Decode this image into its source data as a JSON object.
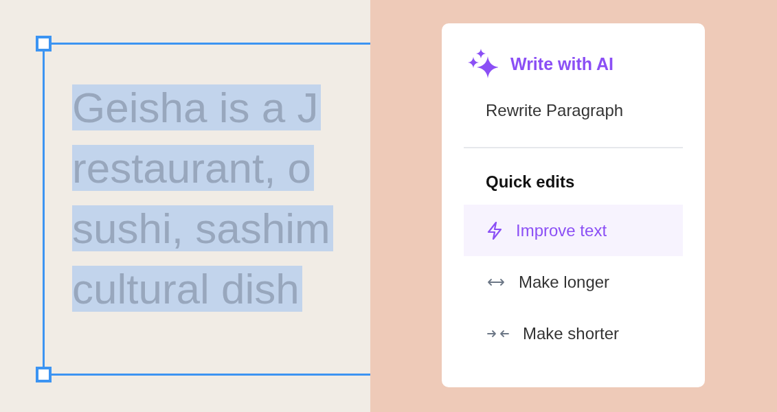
{
  "text_box": {
    "selected": true,
    "highlighted": true,
    "lines": [
      "Geisha is a J",
      "restaurant, o",
      "sushi, sashim",
      "cultural dish"
    ]
  },
  "ai_menu": {
    "title": "Write with AI",
    "rewrite_option": "Rewrite Paragraph",
    "section_title": "Quick edits",
    "items": [
      {
        "kind": "improve",
        "label": "Improve text",
        "selected": true
      },
      {
        "kind": "longer",
        "label": "Make longer",
        "selected": false
      },
      {
        "kind": "shorter",
        "label": "Make shorter",
        "selected": false
      }
    ]
  }
}
